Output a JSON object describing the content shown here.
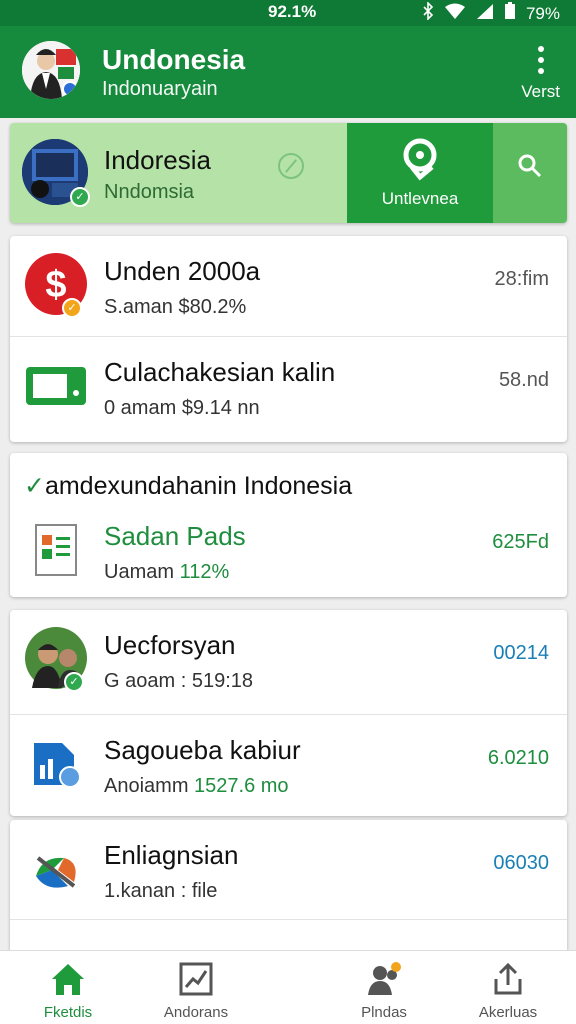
{
  "status": {
    "time": "92.1%",
    "battery": "79%"
  },
  "app_bar": {
    "title": "Undonesia",
    "subtitle": "Indonuaryain",
    "more_label": "Verst"
  },
  "highlight": {
    "title": "Indoresia",
    "subtitle": "Nndomsia",
    "action_label": "Untlevnea"
  },
  "list1": [
    {
      "title": "Unden 2000a",
      "sub_prefix": "S.aman",
      "sub_value": "$80.2%",
      "value": "28:fim"
    },
    {
      "title": "Culachakesian kalin",
      "sub_prefix": "0 amam",
      "sub_value": "$9.14 nn",
      "value": "58.nd"
    }
  ],
  "section2": {
    "title": "amdexundahanin Indonesia",
    "row": {
      "title": "Sadan Pads",
      "sub_prefix": "Uamam",
      "sub_value": "112%",
      "value": "625Fd"
    }
  },
  "list3": [
    {
      "title": "Uecforsyan",
      "sub_prefix": "G aoam :",
      "sub_value": "519:18",
      "value": "00214"
    },
    {
      "title": "Sagoueba kabiur",
      "sub_prefix": "Anoiamm",
      "sub_value": "1527.6 mo",
      "value": "6.0210"
    },
    {
      "title": "Enliagnsian",
      "sub_prefix": "1.kanan :",
      "sub_value": "file",
      "value": "06030"
    }
  ],
  "bottom_nav": [
    {
      "label": "Fketdis",
      "icon": "home-icon"
    },
    {
      "label": "Andorans",
      "icon": "chart-icon"
    },
    {
      "label": "Plndas",
      "icon": "people-icon"
    },
    {
      "label": "Akerluas",
      "icon": "share-icon"
    }
  ],
  "colors": {
    "primary": "#168a3d",
    "primary_dark": "#0f7a35",
    "highlight_bg": "#b5e2a6",
    "accent_green": "#1e8e3e",
    "accent_blue": "#1a7fb5"
  }
}
